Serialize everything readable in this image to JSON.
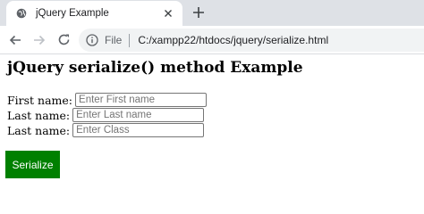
{
  "browser": {
    "tab": {
      "title": "jQuery Example"
    },
    "address": {
      "scheme_label": "File",
      "url": "C:/xampp22/htdocs/jquery/serialize.html"
    }
  },
  "page": {
    "heading": "jQuery serialize() method Example",
    "form": {
      "fields": [
        {
          "label": "First name:",
          "value": "",
          "placeholder": "Enter First name"
        },
        {
          "label": "Last name:",
          "value": "",
          "placeholder": "Enter Last name"
        },
        {
          "label": "Last name:",
          "value": "",
          "placeholder": "Enter Class"
        }
      ],
      "button_label": "Serialize"
    }
  },
  "colors": {
    "button_bg": "#008000",
    "button_text": "#ffffff",
    "tabstrip_bg": "#dee1e6",
    "omnibox_bg": "#f1f3f4"
  },
  "icons": [
    "globe-icon",
    "close-icon",
    "plus-icon",
    "arrow-left-icon",
    "arrow-right-icon",
    "reload-icon",
    "info-icon"
  ]
}
